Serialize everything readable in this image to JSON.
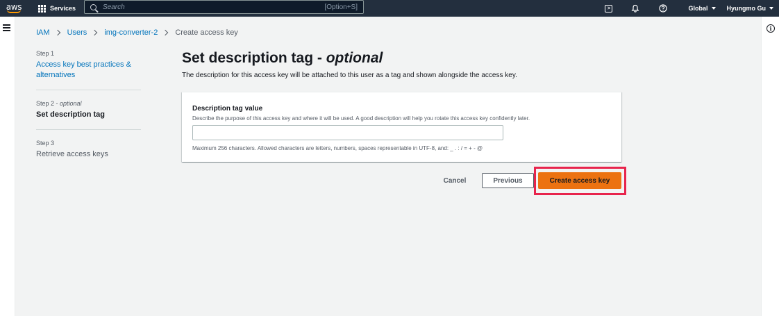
{
  "topnav": {
    "logo_text": "aws",
    "services_label": "Services",
    "search_placeholder": "Search",
    "search_shortcut": "[Option+S]",
    "region": "Global",
    "user": "Hyungmo Gu"
  },
  "breadcrumb": [
    {
      "label": "IAM"
    },
    {
      "label": "Users"
    },
    {
      "label": "img-converter-2"
    },
    {
      "label": "Create access key"
    }
  ],
  "steps": [
    {
      "number": "Step 1",
      "title": "Access key best practices & alternatives"
    },
    {
      "number": "Step 2",
      "optional": "optional",
      "title": "Set description tag"
    },
    {
      "number": "Step 3",
      "title": "Retrieve access keys"
    }
  ],
  "main": {
    "title": "Set description tag - ",
    "title_optional": "optional",
    "description": "The description for this access key will be attached to this user as a tag and shown alongside the access key.",
    "field": {
      "label": "Description tag value",
      "description": "Describe the purpose of this access key and where it will be used. A good description will help you rotate this access key confidently later.",
      "value": "",
      "constraint": "Maximum 256 characters. Allowed characters are letters, numbers, spaces representable in UTF-8, and: _ . : / = + - @"
    }
  },
  "actions": {
    "cancel": "Cancel",
    "previous": "Previous",
    "create": "Create access key"
  },
  "colors": {
    "nav_bg": "#232f3e",
    "link": "#0073bb",
    "primary_button": "#ec7211",
    "highlight": "#e8244c"
  }
}
